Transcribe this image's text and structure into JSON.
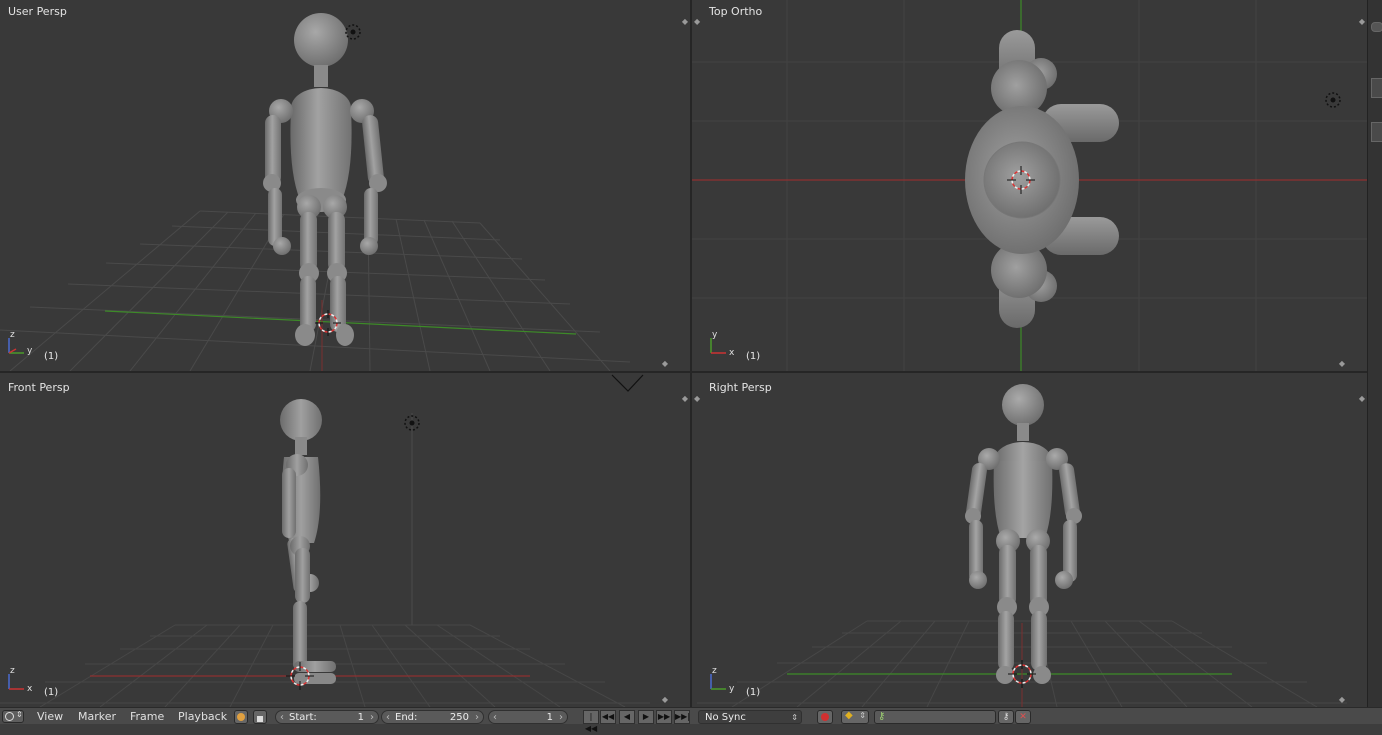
{
  "viewports": {
    "top_left": {
      "label": "User Persp",
      "frame": "(1)"
    },
    "top_right": {
      "label": "Top Ortho",
      "frame": "(1)"
    },
    "bottom_left": {
      "label": "Front Persp",
      "frame": "(1)"
    },
    "bottom_right": {
      "label": "Right Persp",
      "frame": "(1)"
    }
  },
  "axis": {
    "z": "z",
    "y": "y",
    "x": "x"
  },
  "timeline": {
    "menu": [
      "View",
      "Marker",
      "Frame",
      "Playback"
    ],
    "start_label": "Start:",
    "start_value": "1",
    "end_label": "End:",
    "end_value": "250",
    "current_frame": "1",
    "sync": "No Sync"
  },
  "colors": {
    "background": "#393939",
    "grid": "#474747",
    "x_axis": "#8f3030",
    "y_axis": "#4a8a2a",
    "z_axis": "#4a6aa0",
    "mesh": "#8c8c8c"
  }
}
